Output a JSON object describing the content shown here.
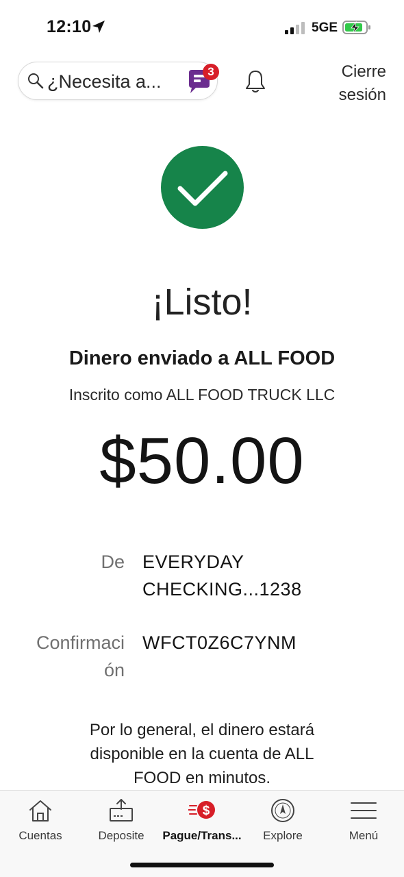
{
  "status_bar": {
    "time": "12:10",
    "network": "5GE",
    "icons": [
      "location-arrow-icon",
      "cellular-signal-icon",
      "battery-charging-icon"
    ]
  },
  "header": {
    "search_placeholder": "¿Necesita a...",
    "fargo_badge_count": "3",
    "logout_line1": "Cierre",
    "logout_line2": "sesión"
  },
  "confirmation": {
    "title": "¡Listo!",
    "subtitle": "Dinero enviado a ALL FOOD",
    "enrolled_as": "Inscrito como ALL FOOD TRUCK LLC",
    "amount": "$50.00",
    "from_label": "De",
    "from_value_line1": "EVERYDAY",
    "from_value_line2": "CHECKING...1238",
    "confirmation_label_line1": "Confirmaci",
    "confirmation_label_line2": "ón",
    "confirmation_value": "WFCT0Z6C7YNM",
    "note": "Por lo general, el dinero estará disponible en la cuenta de ALL FOOD en minutos."
  },
  "bottom_nav": {
    "items": [
      {
        "label": "Cuentas",
        "icon": "home-icon"
      },
      {
        "label": "Deposite",
        "icon": "deposit-icon"
      },
      {
        "label": "Pague/Trans...",
        "icon": "pay-transfer-icon",
        "active": true
      },
      {
        "label": "Explore",
        "icon": "compass-icon"
      },
      {
        "label": "Menú",
        "icon": "menu-icon"
      }
    ]
  },
  "colors": {
    "success_green": "#16844a",
    "badge_red": "#d71e28",
    "fargo_purple": "#6b2d8f",
    "battery_green": "#32c94a"
  }
}
